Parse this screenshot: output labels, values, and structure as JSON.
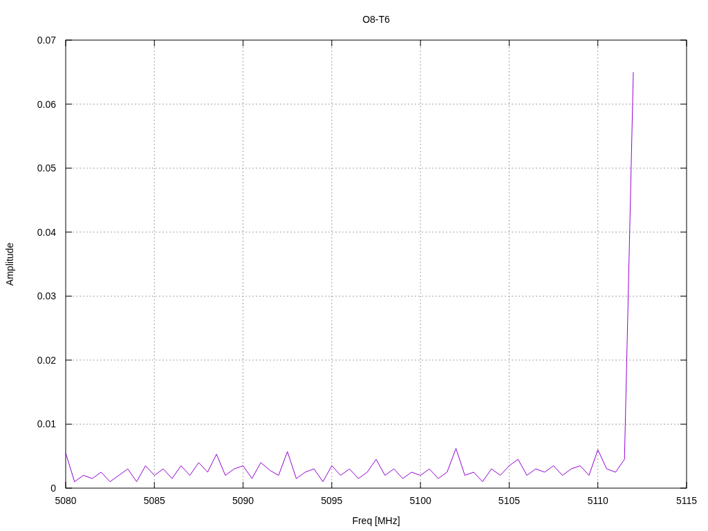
{
  "chart_data": {
    "type": "line",
    "title": "O8-T6",
    "xlabel": "Freq [MHz]",
    "ylabel": "Amplitude",
    "x": [
      5080,
      5080.5,
      5081,
      5081.5,
      5082,
      5082.5,
      5083,
      5083.5,
      5084,
      5084.5,
      5085,
      5085.5,
      5086,
      5086.5,
      5087,
      5087.5,
      5088,
      5088.5,
      5089,
      5089.5,
      5090,
      5090.5,
      5091,
      5091.5,
      5092,
      5092.5,
      5093,
      5093.5,
      5094,
      5094.5,
      5095,
      5095.5,
      5096,
      5096.5,
      5097,
      5097.5,
      5098,
      5098.5,
      5099,
      5099.5,
      5100,
      5100.5,
      5101,
      5101.5,
      5102,
      5102.5,
      5103,
      5103.5,
      5104,
      5104.5,
      5105,
      5105.5,
      5106,
      5106.5,
      5107,
      5107.5,
      5108,
      5108.5,
      5109,
      5109.5,
      5110,
      5110.5,
      5111,
      5111.5,
      5112
    ],
    "grid": true,
    "series": [
      {
        "color": "#9400d3",
        "values": [
          0.0055,
          0.001,
          0.002,
          0.0015,
          0.0025,
          0.001,
          0.002,
          0.003,
          0.001,
          0.0035,
          0.002,
          0.003,
          0.0015,
          0.0035,
          0.002,
          0.004,
          0.0025,
          0.0053,
          0.002,
          0.003,
          0.0035,
          0.0015,
          0.004,
          0.0028,
          0.002,
          0.0057,
          0.0015,
          0.0025,
          0.003,
          0.001,
          0.0035,
          0.002,
          0.003,
          0.0015,
          0.0025,
          0.0045,
          0.002,
          0.003,
          0.0015,
          0.0025,
          0.002,
          0.003,
          0.0015,
          0.0025,
          0.0062,
          0.002,
          0.0025,
          0.001,
          0.003,
          0.002,
          0.0035,
          0.0045,
          0.002,
          0.003,
          0.0025,
          0.0035,
          0.002,
          0.003,
          0.0035,
          0.002,
          0.006,
          0.003,
          0.0025,
          0.0045,
          0.065
        ]
      }
    ],
    "xlim": [
      5080,
      5115
    ],
    "ylim": [
      0,
      0.07
    ],
    "xticks": [
      5080,
      5085,
      5090,
      5095,
      5100,
      5105,
      5110,
      5115
    ],
    "yticks": [
      0,
      0.01,
      0.02,
      0.03,
      0.04,
      0.05,
      0.06,
      0.07
    ]
  }
}
